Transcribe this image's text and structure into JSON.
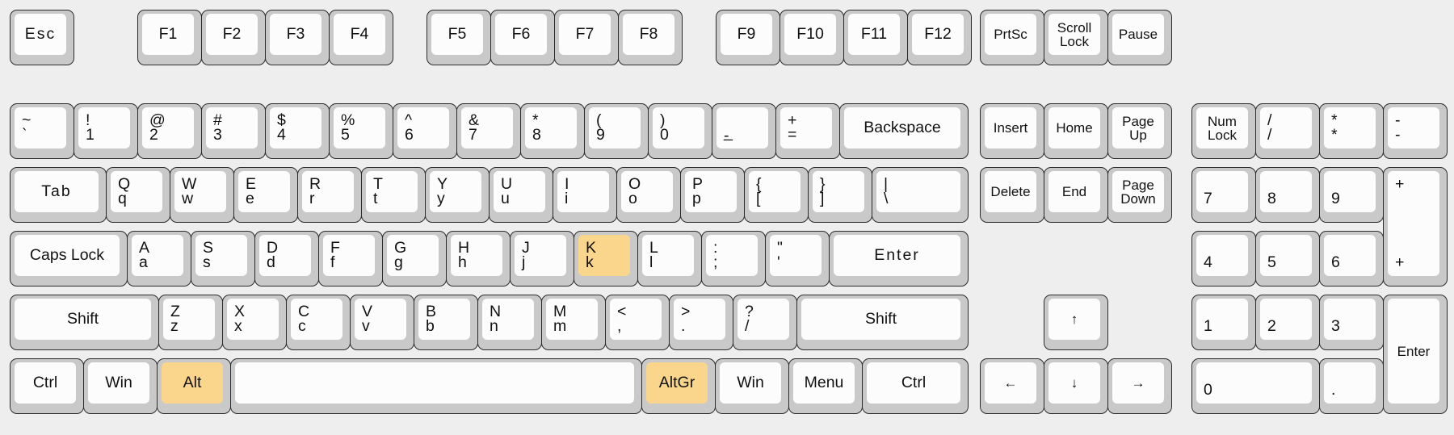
{
  "theme": {
    "background": "#eeeeee",
    "key_base": "#c9c9c9",
    "key_cap": "#fcfcfc",
    "key_border": "#2b2b2b",
    "label_color": "#111111",
    "highlight": "#fad68c"
  },
  "highlighted_keys": [
    "K",
    "Alt",
    "AltGr"
  ],
  "rows": {
    "function_row": [
      {
        "name": "escape",
        "label": "Esc"
      },
      {
        "name": "f1",
        "label": "F1"
      },
      {
        "name": "f2",
        "label": "F2"
      },
      {
        "name": "f3",
        "label": "F3"
      },
      {
        "name": "f4",
        "label": "F4"
      },
      {
        "name": "f5",
        "label": "F5"
      },
      {
        "name": "f6",
        "label": "F6"
      },
      {
        "name": "f7",
        "label": "F7"
      },
      {
        "name": "f8",
        "label": "F8"
      },
      {
        "name": "f9",
        "label": "F9"
      },
      {
        "name": "f10",
        "label": "F10"
      },
      {
        "name": "f11",
        "label": "F11"
      },
      {
        "name": "f12",
        "label": "F12"
      },
      {
        "name": "print-screen",
        "label": "PrtSc"
      },
      {
        "name": "scroll-lock",
        "line1": "Scroll",
        "line2": "Lock"
      },
      {
        "name": "pause",
        "label": "Pause"
      }
    ],
    "number_row": [
      {
        "name": "backquote",
        "shift": "~",
        "base": "`"
      },
      {
        "name": "digit-1",
        "shift": "!",
        "base": "1"
      },
      {
        "name": "digit-2",
        "shift": "@",
        "base": "2"
      },
      {
        "name": "digit-3",
        "shift": "#",
        "base": "3"
      },
      {
        "name": "digit-4",
        "shift": "$",
        "base": "4"
      },
      {
        "name": "digit-5",
        "shift": "%",
        "base": "5"
      },
      {
        "name": "digit-6",
        "shift": "^",
        "base": "6"
      },
      {
        "name": "digit-7",
        "shift": "&",
        "base": "7"
      },
      {
        "name": "digit-8",
        "shift": "*",
        "base": "8"
      },
      {
        "name": "digit-9",
        "shift": "(",
        "base": "9"
      },
      {
        "name": "digit-0",
        "shift": ")",
        "base": "0"
      },
      {
        "name": "minus",
        "shift": "_",
        "base": "-"
      },
      {
        "name": "equal",
        "shift": "+",
        "base": "="
      },
      {
        "name": "backspace",
        "label": "Backspace"
      }
    ],
    "top_row": [
      {
        "name": "tab",
        "label": "Tab"
      },
      {
        "name": "key-q",
        "shift": "Q",
        "base": "q"
      },
      {
        "name": "key-w",
        "shift": "W",
        "base": "w"
      },
      {
        "name": "key-e",
        "shift": "E",
        "base": "e"
      },
      {
        "name": "key-r",
        "shift": "R",
        "base": "r"
      },
      {
        "name": "key-t",
        "shift": "T",
        "base": "t"
      },
      {
        "name": "key-y",
        "shift": "Y",
        "base": "y"
      },
      {
        "name": "key-u",
        "shift": "U",
        "base": "u"
      },
      {
        "name": "key-i",
        "shift": "I",
        "base": "i"
      },
      {
        "name": "key-o",
        "shift": "O",
        "base": "o"
      },
      {
        "name": "key-p",
        "shift": "P",
        "base": "p"
      },
      {
        "name": "bracket-left",
        "shift": "{",
        "base": "["
      },
      {
        "name": "bracket-right",
        "shift": "}",
        "base": "]"
      },
      {
        "name": "backslash",
        "shift": "|",
        "base": "\\"
      }
    ],
    "home_row": [
      {
        "name": "caps-lock",
        "label": "Caps Lock"
      },
      {
        "name": "key-a",
        "shift": "A",
        "base": "a"
      },
      {
        "name": "key-s",
        "shift": "S",
        "base": "s"
      },
      {
        "name": "key-d",
        "shift": "D",
        "base": "d"
      },
      {
        "name": "key-f",
        "shift": "F",
        "base": "f"
      },
      {
        "name": "key-g",
        "shift": "G",
        "base": "g"
      },
      {
        "name": "key-h",
        "shift": "H",
        "base": "h"
      },
      {
        "name": "key-j",
        "shift": "J",
        "base": "j"
      },
      {
        "name": "key-k",
        "shift": "K",
        "base": "k",
        "highlight": true
      },
      {
        "name": "key-l",
        "shift": "L",
        "base": "l"
      },
      {
        "name": "semicolon",
        "shift": ":",
        "base": ";"
      },
      {
        "name": "quote",
        "shift": "\"",
        "base": "'"
      },
      {
        "name": "enter",
        "label": "Enter"
      }
    ],
    "bottom_row": [
      {
        "name": "shift-left",
        "label": "Shift"
      },
      {
        "name": "key-z",
        "shift": "Z",
        "base": "z"
      },
      {
        "name": "key-x",
        "shift": "X",
        "base": "x"
      },
      {
        "name": "key-c",
        "shift": "C",
        "base": "c"
      },
      {
        "name": "key-v",
        "shift": "V",
        "base": "v"
      },
      {
        "name": "key-b",
        "shift": "B",
        "base": "b"
      },
      {
        "name": "key-n",
        "shift": "N",
        "base": "n"
      },
      {
        "name": "key-m",
        "shift": "M",
        "base": "m"
      },
      {
        "name": "comma",
        "shift": "<",
        "base": ","
      },
      {
        "name": "period",
        "shift": ">",
        "base": "."
      },
      {
        "name": "slash",
        "shift": "?",
        "base": "/"
      },
      {
        "name": "shift-right",
        "label": "Shift"
      }
    ],
    "modifier_row": [
      {
        "name": "control-left",
        "label": "Ctrl"
      },
      {
        "name": "win-left",
        "label": "Win"
      },
      {
        "name": "alt-left",
        "label": "Alt",
        "highlight": true
      },
      {
        "name": "space",
        "label": ""
      },
      {
        "name": "alt-gr",
        "label": "AltGr",
        "highlight": true
      },
      {
        "name": "win-right",
        "label": "Win"
      },
      {
        "name": "menu",
        "label": "Menu"
      },
      {
        "name": "control-right",
        "label": "Ctrl"
      }
    ]
  },
  "navigation_cluster": [
    {
      "name": "insert",
      "label": "Insert"
    },
    {
      "name": "home",
      "label": "Home"
    },
    {
      "name": "page-up",
      "line1": "Page",
      "line2": "Up"
    },
    {
      "name": "delete",
      "label": "Delete"
    },
    {
      "name": "end",
      "label": "End"
    },
    {
      "name": "page-down",
      "line1": "Page",
      "line2": "Down"
    }
  ],
  "arrow_cluster": [
    {
      "name": "arrow-up",
      "label": "↑"
    },
    {
      "name": "arrow-left",
      "label": "←"
    },
    {
      "name": "arrow-down",
      "label": "↓"
    },
    {
      "name": "arrow-right",
      "label": "→"
    }
  ],
  "numpad": [
    {
      "name": "num-lock",
      "line1": "Num",
      "line2": "Lock"
    },
    {
      "name": "numpad-divide",
      "shift": "/",
      "base": "/"
    },
    {
      "name": "numpad-multiply",
      "shift": "*",
      "base": "*"
    },
    {
      "name": "numpad-subtract",
      "shift": "-",
      "base": "-"
    },
    {
      "name": "numpad-7",
      "label": "7"
    },
    {
      "name": "numpad-8",
      "label": "8"
    },
    {
      "name": "numpad-9",
      "label": "9"
    },
    {
      "name": "numpad-add",
      "shift": "+",
      "base": "+"
    },
    {
      "name": "numpad-4",
      "label": "4"
    },
    {
      "name": "numpad-5",
      "label": "5"
    },
    {
      "name": "numpad-6",
      "label": "6"
    },
    {
      "name": "numpad-1",
      "label": "1"
    },
    {
      "name": "numpad-2",
      "label": "2"
    },
    {
      "name": "numpad-3",
      "label": "3"
    },
    {
      "name": "numpad-enter",
      "label": "Enter"
    },
    {
      "name": "numpad-0",
      "label": "0"
    },
    {
      "name": "numpad-decimal",
      "label": "."
    }
  ]
}
